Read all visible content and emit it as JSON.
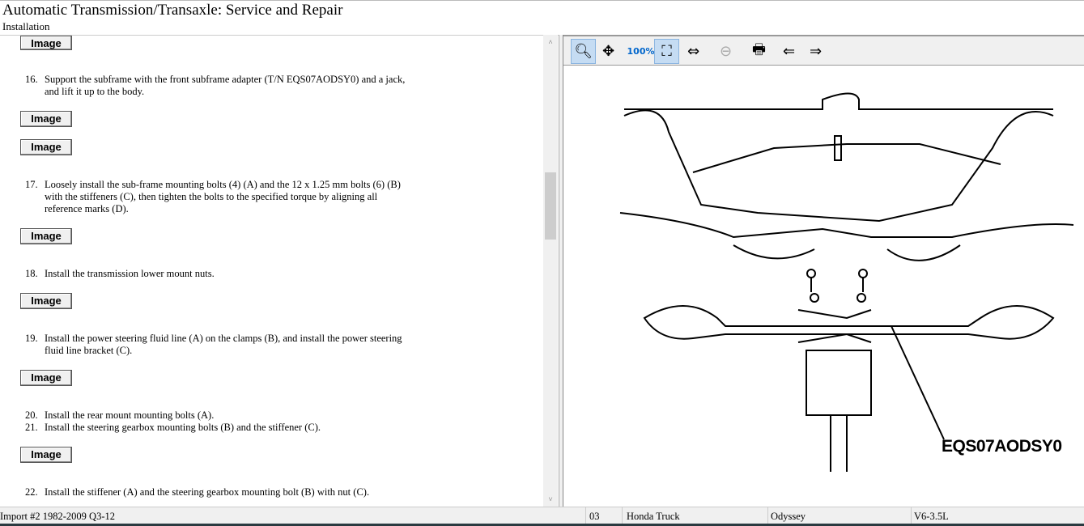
{
  "header": {
    "title": "Automatic Transmission/Transaxle:  Service and Repair",
    "subtitle": "Installation"
  },
  "content": {
    "image_label": "Image",
    "steps": [
      {
        "num": "16.",
        "text": "Support the subframe with the front subframe adapter (T/N EQS07AODSY0) and a jack, and lift it up to the body."
      },
      {
        "num": "17.",
        "text": "Loosely install the sub-frame mounting bolts (4) (A) and the 12 x 1.25 mm bolts (6) (B) with the stiffeners (C), then tighten the bolts to the specified torque by aligning all reference marks (D)."
      },
      {
        "num": "18.",
        "text": "Install the transmission lower mount nuts."
      },
      {
        "num": "19.",
        "text": "Install the power steering fluid line (A) on the clamps (B), and install the power steering fluid line bracket (C)."
      },
      {
        "num": "20.",
        "text": "Install the rear mount mounting bolts (A)."
      },
      {
        "num": "21.",
        "text": "Install the steering gearbox mounting bolts (B) and the stiffener (C)."
      },
      {
        "num": "22.",
        "text": "Install the stiffener (A) and the steering gearbox mounting bolt (B) with nut (C)."
      }
    ]
  },
  "toolbar": {
    "icons": [
      "zoom-in",
      "pan",
      "zoom-100",
      "zoom-fit",
      "zoom-width",
      "zoom-out",
      "print",
      "previous-image",
      "next-image"
    ]
  },
  "diagram": {
    "label": "EQS07AODSY0"
  },
  "status": {
    "source": "Import #2 1982-2009 Q3-12",
    "code": "03",
    "make": "Honda Truck",
    "model": "Odyssey",
    "engine": "V6-3.5L"
  }
}
